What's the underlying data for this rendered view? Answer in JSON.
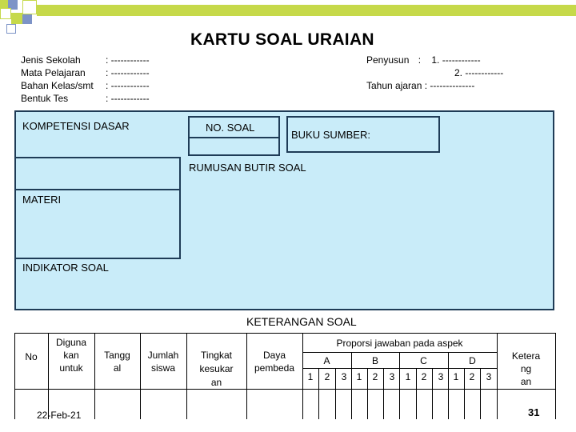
{
  "title": "KARTU SOAL URAIAN",
  "meta_left": [
    {
      "label": "Jenis Sekolah",
      "value": ": ------------"
    },
    {
      "label": "Mata Pelajaran",
      "value": ": ------------"
    },
    {
      "label": "Bahan Kelas/smt",
      "value": ": ------------"
    },
    {
      "label": "Bentuk Tes",
      "value": ": ------------"
    }
  ],
  "meta_right": {
    "penyusun_label": "Penyusun",
    "penyusun_sep": ":",
    "penyusun_1": "1.  ------------",
    "penyusun_2": "2. ------------",
    "tahun_ajaran": "Tahun ajaran : --------------"
  },
  "panel": {
    "kompetensi_dasar": "KOMPETENSI  DASAR",
    "no_soal": "NO. SOAL",
    "buku_sumber": "BUKU  SUMBER:",
    "rumusan_butir_soal": "RUMUSAN  BUTIR  SOAL",
    "materi": "MATERI",
    "indikator_soal": "INDIKATOR  SOAL"
  },
  "keterangan": {
    "title": "KETERANGAN SOAL",
    "col_no": "No",
    "col_digunakan": [
      "Diguna",
      "kan",
      "untuk"
    ],
    "col_tanggal": [
      "Tangg",
      "al"
    ],
    "col_jumlah": [
      "Jumlah",
      "siswa"
    ],
    "col_tingkat": [
      "Tingkat",
      "kesukar",
      "an"
    ],
    "col_daya": [
      "Daya",
      "pembeda"
    ],
    "proporsi": "Proporsi jawaban pada aspek",
    "aspek": [
      "A",
      "B",
      "C",
      "D"
    ],
    "sub_numbers": [
      "1",
      "2",
      "3"
    ],
    "col_keterangan": [
      "Ketera",
      "ng",
      "an"
    ]
  },
  "footer": {
    "date": "22-Feb-21",
    "page": "31"
  },
  "colors": {
    "panel_bg": "#c9ecf9",
    "border": "#1f3c57",
    "deco_lime": "#c6d94a",
    "deco_blue": "#7d93c7"
  }
}
